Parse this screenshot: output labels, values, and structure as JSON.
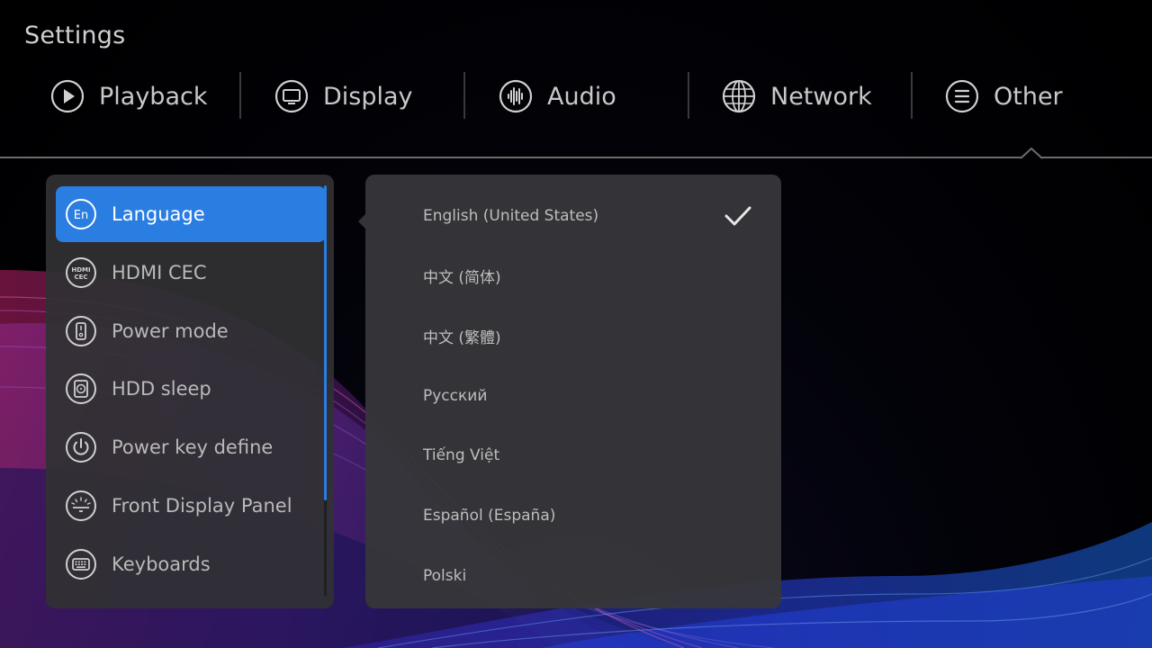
{
  "header": {
    "title": "Settings"
  },
  "tabs": [
    {
      "label": "Playback",
      "icon": "play-circle-icon"
    },
    {
      "label": "Display",
      "icon": "monitor-icon"
    },
    {
      "label": "Audio",
      "icon": "sound-wave-icon"
    },
    {
      "label": "Network",
      "icon": "globe-icon"
    },
    {
      "label": "Other",
      "icon": "menu-lines-icon",
      "selected": true
    }
  ],
  "sidebar": {
    "items": [
      {
        "label": "Language",
        "icon": "language-en-icon",
        "icon_text": "En",
        "active": true
      },
      {
        "label": "HDMI CEC",
        "icon": "hdmi-cec-icon",
        "icon_text": "HDMI CEC"
      },
      {
        "label": "Power mode",
        "icon": "phone-power-icon"
      },
      {
        "label": "HDD sleep",
        "icon": "hdd-icon"
      },
      {
        "label": "Power key define",
        "icon": "power-icon"
      },
      {
        "label": "Front Display Panel",
        "icon": "front-panel-icon"
      },
      {
        "label": "Keyboards",
        "icon": "keyboard-icon"
      }
    ]
  },
  "languages": {
    "options": [
      {
        "label": "English (United States)",
        "selected": true
      },
      {
        "label": "中文 (简体)"
      },
      {
        "label": "中文 (繁體)"
      },
      {
        "label": "Русский"
      },
      {
        "label": "Tiếng Việt"
      },
      {
        "label": "Español (España)"
      },
      {
        "label": "Polski"
      }
    ]
  },
  "colors": {
    "accent": "#2a7de1",
    "panel": "#303034",
    "text": "#c8c8c8"
  }
}
